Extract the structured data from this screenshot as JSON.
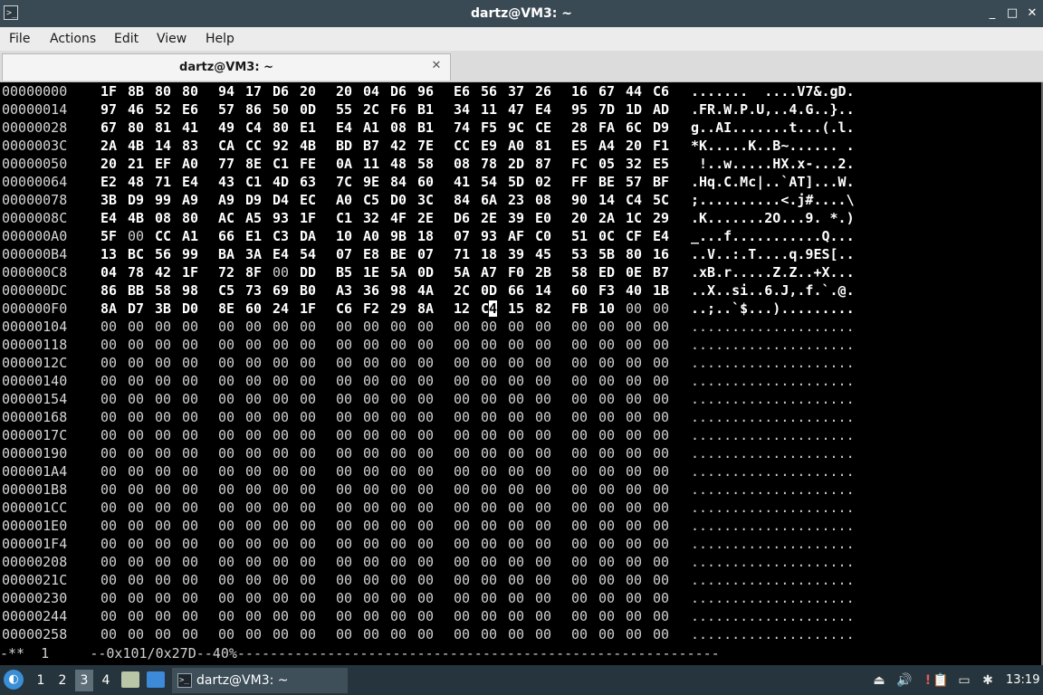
{
  "window": {
    "title": "dartz@VM3: ~",
    "app_icon": ">_",
    "minimize": "_",
    "maximize": "□",
    "close": "✕"
  },
  "menu": {
    "file": "File",
    "actions": "Actions",
    "edit": "Edit",
    "view": "View",
    "help": "Help"
  },
  "tab": {
    "label": "dartz@VM3: ~",
    "close": "✕"
  },
  "hexdump": {
    "cursor": {
      "row": 12,
      "col": 13,
      "char_index": 1
    },
    "rows": [
      {
        "offset": "00000000",
        "bytes": [
          "1F",
          "8B",
          "80",
          "80",
          "94",
          "17",
          "D6",
          "20",
          "20",
          "04",
          "D6",
          "96",
          "E6",
          "56",
          "37",
          "26",
          "16",
          "67",
          "44",
          "C6"
        ],
        "ascii": ".......  ....V7&.gD."
      },
      {
        "offset": "00000014",
        "bytes": [
          "97",
          "46",
          "52",
          "E6",
          "57",
          "86",
          "50",
          "0D",
          "55",
          "2C",
          "F6",
          "B1",
          "34",
          "11",
          "47",
          "E4",
          "95",
          "7D",
          "1D",
          "AD"
        ],
        "ascii": ".FR.W.P.U,..4.G..}.."
      },
      {
        "offset": "00000028",
        "bytes": [
          "67",
          "80",
          "81",
          "41",
          "49",
          "C4",
          "80",
          "E1",
          "E4",
          "A1",
          "08",
          "B1",
          "74",
          "F5",
          "9C",
          "CE",
          "28",
          "FA",
          "6C",
          "D9"
        ],
        "ascii": "g..AI.......t...(.l."
      },
      {
        "offset": "0000003C",
        "bytes": [
          "2A",
          "4B",
          "14",
          "83",
          "CA",
          "CC",
          "92",
          "4B",
          "BD",
          "B7",
          "42",
          "7E",
          "CC",
          "E9",
          "A0",
          "81",
          "E5",
          "A4",
          "20",
          "F1"
        ],
        "ascii": "*K.....K..B~...... ."
      },
      {
        "offset": "00000050",
        "bytes": [
          "20",
          "21",
          "EF",
          "A0",
          "77",
          "8E",
          "C1",
          "FE",
          "0A",
          "11",
          "48",
          "58",
          "08",
          "78",
          "2D",
          "87",
          "FC",
          "05",
          "32",
          "E5"
        ],
        "ascii": " !..w.....HX.x-...2."
      },
      {
        "offset": "00000064",
        "bytes": [
          "E2",
          "48",
          "71",
          "E4",
          "43",
          "C1",
          "4D",
          "63",
          "7C",
          "9E",
          "84",
          "60",
          "41",
          "54",
          "5D",
          "02",
          "FF",
          "BE",
          "57",
          "BF"
        ],
        "ascii": ".Hq.C.Mc|..`AT]...W."
      },
      {
        "offset": "00000078",
        "bytes": [
          "3B",
          "D9",
          "99",
          "A9",
          "A9",
          "D9",
          "D4",
          "EC",
          "A0",
          "C5",
          "D0",
          "3C",
          "84",
          "6A",
          "23",
          "08",
          "90",
          "14",
          "C4",
          "5C"
        ],
        "ascii": ";..........<.j#....\\"
      },
      {
        "offset": "0000008C",
        "bytes": [
          "E4",
          "4B",
          "08",
          "80",
          "AC",
          "A5",
          "93",
          "1F",
          "C1",
          "32",
          "4F",
          "2E",
          "D6",
          "2E",
          "39",
          "E0",
          "20",
          "2A",
          "1C",
          "29"
        ],
        "ascii": ".K.......2O...9. *.)"
      },
      {
        "offset": "000000A0",
        "bytes": [
          "5F",
          "00",
          "CC",
          "A1",
          "66",
          "E1",
          "C3",
          "DA",
          "10",
          "A0",
          "9B",
          "18",
          "07",
          "93",
          "AF",
          "C0",
          "51",
          "0C",
          "CF",
          "E4"
        ],
        "ascii": "_...f...........Q..."
      },
      {
        "offset": "000000B4",
        "bytes": [
          "13",
          "BC",
          "56",
          "99",
          "BA",
          "3A",
          "E4",
          "54",
          "07",
          "E8",
          "BE",
          "07",
          "71",
          "18",
          "39",
          "45",
          "53",
          "5B",
          "80",
          "16"
        ],
        "ascii": "..V..:.T....q.9ES[.."
      },
      {
        "offset": "000000C8",
        "bytes": [
          "04",
          "78",
          "42",
          "1F",
          "72",
          "8F",
          "00",
          "DD",
          "B5",
          "1E",
          "5A",
          "0D",
          "5A",
          "A7",
          "F0",
          "2B",
          "58",
          "ED",
          "0E",
          "B7"
        ],
        "ascii": ".xB.r.....Z.Z..+X..."
      },
      {
        "offset": "000000DC",
        "bytes": [
          "86",
          "BB",
          "58",
          "98",
          "C5",
          "73",
          "69",
          "B0",
          "A3",
          "36",
          "98",
          "4A",
          "2C",
          "0D",
          "66",
          "14",
          "60",
          "F3",
          "40",
          "1B"
        ],
        "ascii": "..X..si..6.J,.f.`.@."
      },
      {
        "offset": "000000F0",
        "bytes": [
          "8A",
          "D7",
          "3B",
          "D0",
          "8E",
          "60",
          "24",
          "1F",
          "C6",
          "F2",
          "29",
          "8A",
          "12",
          "C4",
          "15",
          "82",
          "FB",
          "10",
          "00",
          "00"
        ],
        "ascii": "..;..`$...)........."
      },
      {
        "offset": "00000104",
        "bytes": [
          "00",
          "00",
          "00",
          "00",
          "00",
          "00",
          "00",
          "00",
          "00",
          "00",
          "00",
          "00",
          "00",
          "00",
          "00",
          "00",
          "00",
          "00",
          "00",
          "00"
        ],
        "ascii": "...................."
      },
      {
        "offset": "00000118",
        "bytes": [
          "00",
          "00",
          "00",
          "00",
          "00",
          "00",
          "00",
          "00",
          "00",
          "00",
          "00",
          "00",
          "00",
          "00",
          "00",
          "00",
          "00",
          "00",
          "00",
          "00"
        ],
        "ascii": "...................."
      },
      {
        "offset": "0000012C",
        "bytes": [
          "00",
          "00",
          "00",
          "00",
          "00",
          "00",
          "00",
          "00",
          "00",
          "00",
          "00",
          "00",
          "00",
          "00",
          "00",
          "00",
          "00",
          "00",
          "00",
          "00"
        ],
        "ascii": "...................."
      },
      {
        "offset": "00000140",
        "bytes": [
          "00",
          "00",
          "00",
          "00",
          "00",
          "00",
          "00",
          "00",
          "00",
          "00",
          "00",
          "00",
          "00",
          "00",
          "00",
          "00",
          "00",
          "00",
          "00",
          "00"
        ],
        "ascii": "...................."
      },
      {
        "offset": "00000154",
        "bytes": [
          "00",
          "00",
          "00",
          "00",
          "00",
          "00",
          "00",
          "00",
          "00",
          "00",
          "00",
          "00",
          "00",
          "00",
          "00",
          "00",
          "00",
          "00",
          "00",
          "00"
        ],
        "ascii": "...................."
      },
      {
        "offset": "00000168",
        "bytes": [
          "00",
          "00",
          "00",
          "00",
          "00",
          "00",
          "00",
          "00",
          "00",
          "00",
          "00",
          "00",
          "00",
          "00",
          "00",
          "00",
          "00",
          "00",
          "00",
          "00"
        ],
        "ascii": "...................."
      },
      {
        "offset": "0000017C",
        "bytes": [
          "00",
          "00",
          "00",
          "00",
          "00",
          "00",
          "00",
          "00",
          "00",
          "00",
          "00",
          "00",
          "00",
          "00",
          "00",
          "00",
          "00",
          "00",
          "00",
          "00"
        ],
        "ascii": "...................."
      },
      {
        "offset": "00000190",
        "bytes": [
          "00",
          "00",
          "00",
          "00",
          "00",
          "00",
          "00",
          "00",
          "00",
          "00",
          "00",
          "00",
          "00",
          "00",
          "00",
          "00",
          "00",
          "00",
          "00",
          "00"
        ],
        "ascii": "...................."
      },
      {
        "offset": "000001A4",
        "bytes": [
          "00",
          "00",
          "00",
          "00",
          "00",
          "00",
          "00",
          "00",
          "00",
          "00",
          "00",
          "00",
          "00",
          "00",
          "00",
          "00",
          "00",
          "00",
          "00",
          "00"
        ],
        "ascii": "...................."
      },
      {
        "offset": "000001B8",
        "bytes": [
          "00",
          "00",
          "00",
          "00",
          "00",
          "00",
          "00",
          "00",
          "00",
          "00",
          "00",
          "00",
          "00",
          "00",
          "00",
          "00",
          "00",
          "00",
          "00",
          "00"
        ],
        "ascii": "...................."
      },
      {
        "offset": "000001CC",
        "bytes": [
          "00",
          "00",
          "00",
          "00",
          "00",
          "00",
          "00",
          "00",
          "00",
          "00",
          "00",
          "00",
          "00",
          "00",
          "00",
          "00",
          "00",
          "00",
          "00",
          "00"
        ],
        "ascii": "...................."
      },
      {
        "offset": "000001E0",
        "bytes": [
          "00",
          "00",
          "00",
          "00",
          "00",
          "00",
          "00",
          "00",
          "00",
          "00",
          "00",
          "00",
          "00",
          "00",
          "00",
          "00",
          "00",
          "00",
          "00",
          "00"
        ],
        "ascii": "...................."
      },
      {
        "offset": "000001F4",
        "bytes": [
          "00",
          "00",
          "00",
          "00",
          "00",
          "00",
          "00",
          "00",
          "00",
          "00",
          "00",
          "00",
          "00",
          "00",
          "00",
          "00",
          "00",
          "00",
          "00",
          "00"
        ],
        "ascii": "...................."
      },
      {
        "offset": "00000208",
        "bytes": [
          "00",
          "00",
          "00",
          "00",
          "00",
          "00",
          "00",
          "00",
          "00",
          "00",
          "00",
          "00",
          "00",
          "00",
          "00",
          "00",
          "00",
          "00",
          "00",
          "00"
        ],
        "ascii": "...................."
      },
      {
        "offset": "0000021C",
        "bytes": [
          "00",
          "00",
          "00",
          "00",
          "00",
          "00",
          "00",
          "00",
          "00",
          "00",
          "00",
          "00",
          "00",
          "00",
          "00",
          "00",
          "00",
          "00",
          "00",
          "00"
        ],
        "ascii": "...................."
      },
      {
        "offset": "00000230",
        "bytes": [
          "00",
          "00",
          "00",
          "00",
          "00",
          "00",
          "00",
          "00",
          "00",
          "00",
          "00",
          "00",
          "00",
          "00",
          "00",
          "00",
          "00",
          "00",
          "00",
          "00"
        ],
        "ascii": "...................."
      },
      {
        "offset": "00000244",
        "bytes": [
          "00",
          "00",
          "00",
          "00",
          "00",
          "00",
          "00",
          "00",
          "00",
          "00",
          "00",
          "00",
          "00",
          "00",
          "00",
          "00",
          "00",
          "00",
          "00",
          "00"
        ],
        "ascii": "...................."
      },
      {
        "offset": "00000258",
        "bytes": [
          "00",
          "00",
          "00",
          "00",
          "00",
          "00",
          "00",
          "00",
          "00",
          "00",
          "00",
          "00",
          "00",
          "00",
          "00",
          "00",
          "00",
          "00",
          "00",
          "00"
        ],
        "ascii": "...................."
      }
    ],
    "status_line": "-**  1     --0x101/0x27D--40%-----------------------------------------------------------"
  },
  "taskbar": {
    "start_icon": "start-menu-icon",
    "workspaces": [
      "1",
      "2",
      "3",
      "4"
    ],
    "active_workspace": "3",
    "task_label": "dartz@VM3: ~",
    "task_icon": ">_",
    "tray": {
      "eject": "⏏",
      "volume": "🔊",
      "updates": "!",
      "clipboard": "📋",
      "network": "▭",
      "bluetooth": "✱"
    },
    "clock": "13:19"
  }
}
